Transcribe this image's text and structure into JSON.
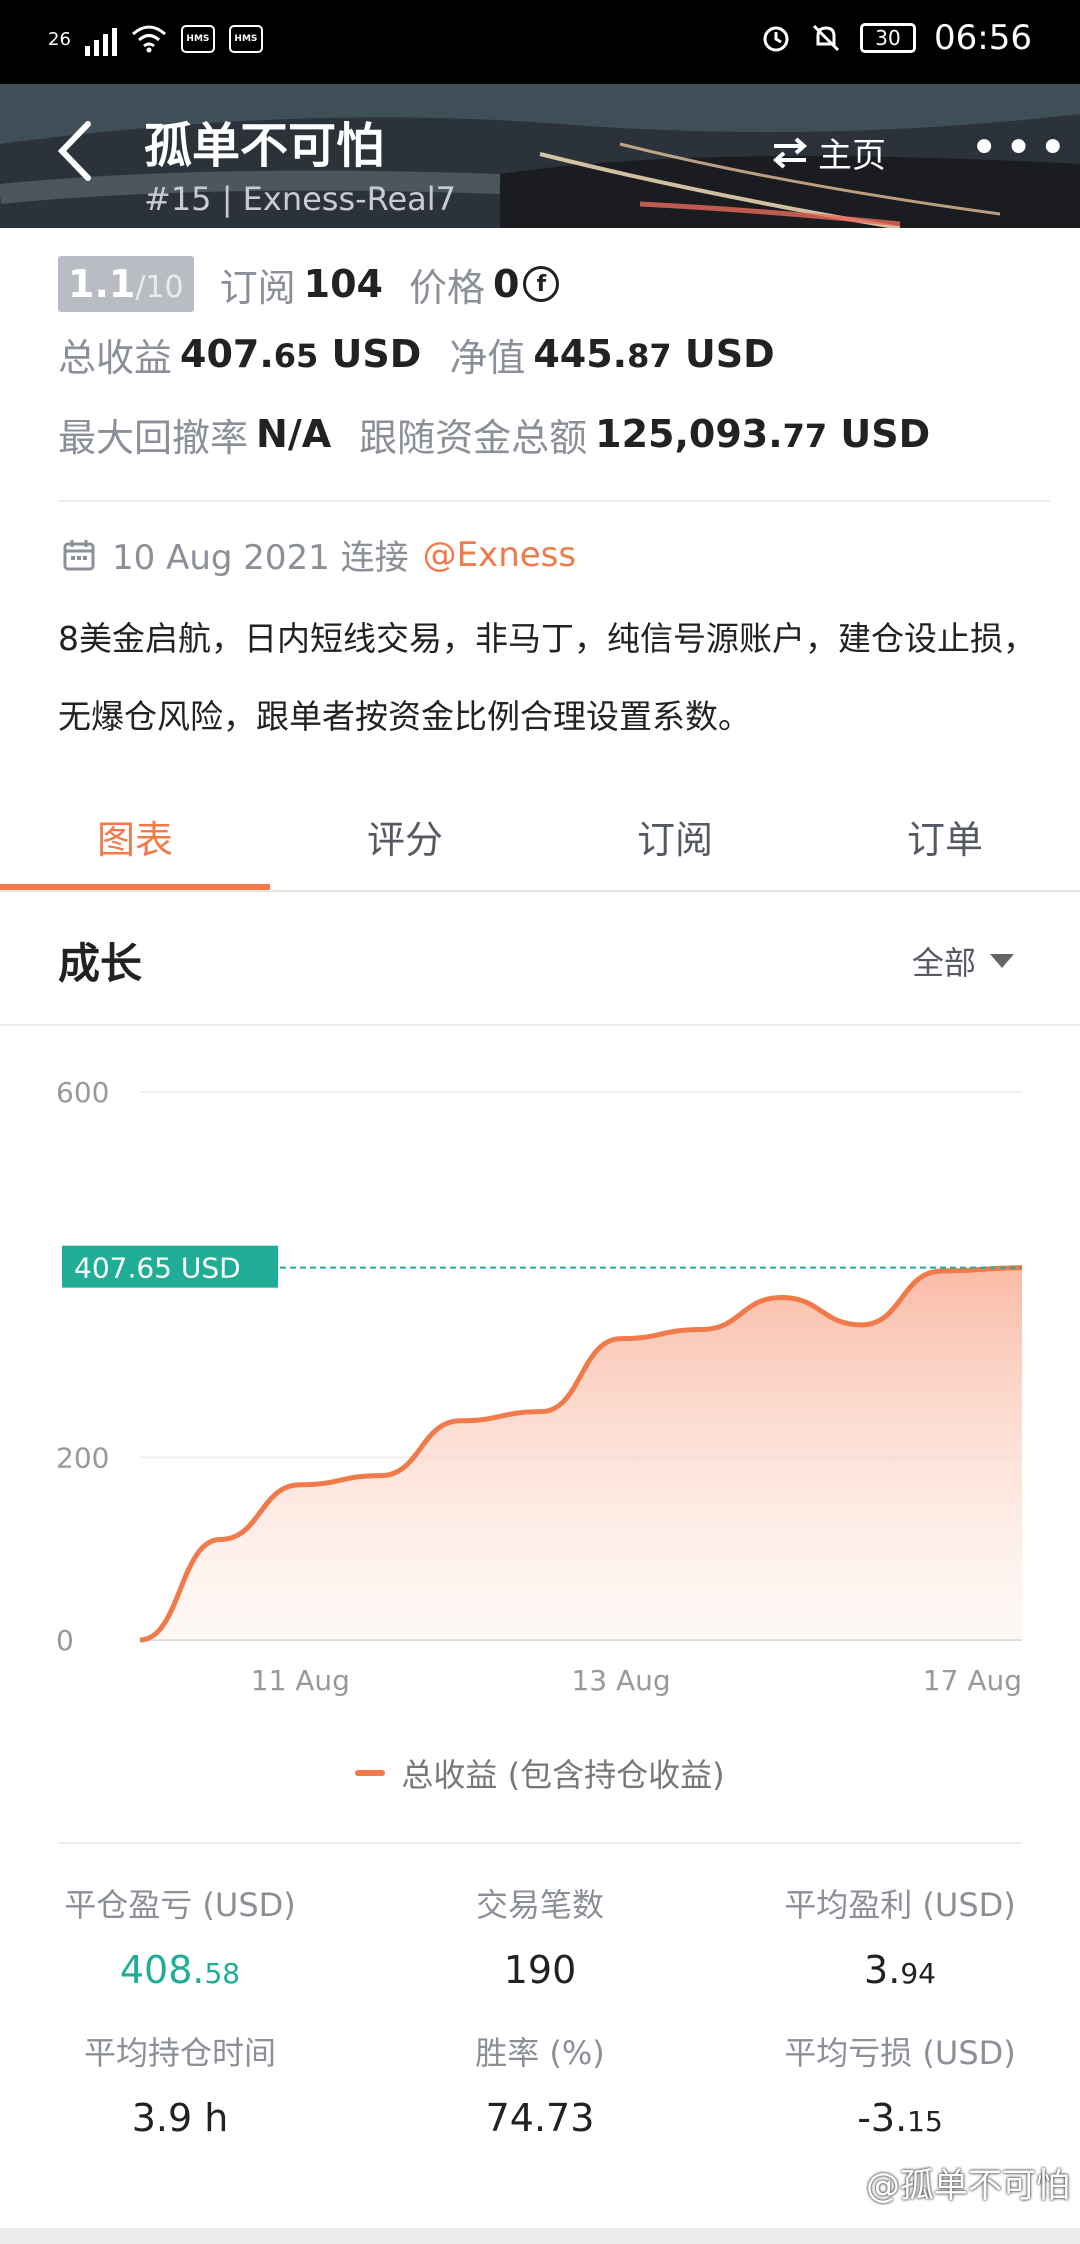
{
  "status_bar": {
    "network": "26",
    "hms1": "HMS",
    "hms2": "HMS",
    "battery": "30",
    "time": "06:56"
  },
  "header": {
    "title": "孤单不可怕",
    "subtitle": "#15 | Exness-Real7",
    "home_label": "主页",
    "more": "•••"
  },
  "info": {
    "rank_main": "1.1",
    "rank_total": "/10",
    "subscribe_label": "订阅",
    "subscribe_value": "104",
    "price_label": "价格",
    "price_value": "0",
    "coin_symbol": "f",
    "total_profit_label": "总收益",
    "total_profit_int": "407.",
    "total_profit_dec": "65",
    "total_profit_unit": " USD",
    "equity_label": "净值",
    "equity_int": "445.",
    "equity_dec": "87",
    "equity_unit": " USD",
    "max_dd_label": "最大回撤率",
    "max_dd_value": "N/A",
    "follow_funds_label": "跟随资金总额",
    "follow_funds_int": "125,093.",
    "follow_funds_dec": "77",
    "follow_funds_unit": " USD"
  },
  "connection": {
    "date_text": "10 Aug 2021 连接",
    "broker_link": "@Exness"
  },
  "description": "8美金启航，日内短线交易，非马丁，纯信号源账户，建仓设止损，无爆仓风险，跟单者按资金比例合理设置系数。",
  "tabs": [
    {
      "label": "图表",
      "active": true
    },
    {
      "label": "评分",
      "active": false
    },
    {
      "label": "订阅",
      "active": false
    },
    {
      "label": "订单",
      "active": false
    }
  ],
  "growth": {
    "title": "成长",
    "range_label": "全部"
  },
  "chart_data": {
    "type": "area",
    "yticks": [
      "600",
      "200",
      "0"
    ],
    "xticks": [
      "11 Aug",
      "13 Aug",
      "17 Aug"
    ],
    "ylim": [
      0,
      600
    ],
    "current_label": "407.65 USD",
    "current_value": 407.65,
    "legend": "总收益 (包含持仓收益)",
    "color": "#f07a49",
    "marker_color": "#1fad95",
    "x": [
      "10 Aug",
      "10.5",
      "11 Aug",
      "11.5",
      "12 Aug",
      "12.5",
      "13 Aug",
      "13.5",
      "14 Aug",
      "15 Aug",
      "16 Aug",
      "17 Aug"
    ],
    "values": [
      0,
      110,
      170,
      180,
      240,
      250,
      330,
      340,
      375,
      345,
      404,
      407.65
    ]
  },
  "stats": [
    {
      "label": "平仓盈亏 (USD)",
      "int": "408.",
      "dec": "58",
      "green": true
    },
    {
      "label": "交易笔数",
      "int": "190",
      "dec": "",
      "green": false
    },
    {
      "label": "平均盈利 (USD)",
      "int": "3.",
      "dec": "94",
      "green": false
    },
    {
      "label": "平均持仓时间",
      "int": "3.9 h",
      "dec": "",
      "green": false
    },
    {
      "label": "胜率 (%)",
      "int": "74.73",
      "dec": "",
      "green": false
    },
    {
      "label": "平均亏损 (USD)",
      "int": "-3.",
      "dec": "15",
      "green": false
    }
  ],
  "watermark": "@孤单不可怕"
}
